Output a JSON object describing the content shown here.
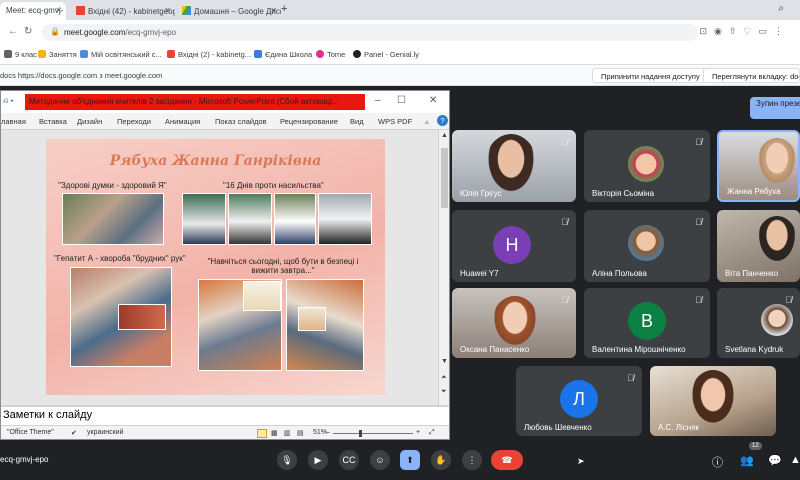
{
  "browser": {
    "tabs": [
      {
        "title": "Meet: ecq-gmvj-",
        "icon": "meet-icon"
      },
      {
        "title": "Вхідні (42) - kabinetgeog",
        "icon": "gmail-icon"
      },
      {
        "title": "Домашня – Google Диск",
        "icon": "drive-icon"
      }
    ],
    "url_host": "meet.google.com",
    "url_path": "/ecq-gmvj-epo",
    "bookmarks": [
      "9 клас",
      "Заняття",
      "Мій освітянський с...",
      "Вхідні (2) - kabinetg...",
      "Єдина Школа",
      "Tome",
      "Panel - Genial.ly"
    ],
    "share_text": "docs https://docs.google.com з meet.google.com",
    "stop_sharing": "Припинити надання доступу",
    "switch_tab": "Переглянути вкладку: docs."
  },
  "ppt": {
    "window_title": "Методичне об'єднання вчителів 2 засідання - Microsoft PowerPoint (Сбой активаці...",
    "ribbon_tabs": [
      "лавная",
      "Вставка",
      "Дизайн",
      "Переходи",
      "Анимация",
      "Показ слайдов",
      "Рецензирование",
      "Вид",
      "WPS PDF"
    ],
    "notes_placeholder": "Заметки к слайду",
    "status_theme": "\"Office Theme\"",
    "status_lang": "украинский",
    "zoom": "51%"
  },
  "slide": {
    "title": "Рябуха Жанна Ганріківна",
    "captions": [
      "\"Здорові думки - здоровий Я\"",
      "\"16 Днів проти насильства\"",
      "\"Гепатит А - хвороба \"брудних\" рук\"",
      "\"Навчіться сьогодні, щоб бути в безпеці і вижити завтра...\""
    ]
  },
  "meet": {
    "stop_presenting": "Зупин презент",
    "participants": [
      {
        "name": "Юлія Грігус",
        "type": "video",
        "muted": true
      },
      {
        "name": "Вікторія Сьоміна",
        "type": "photo",
        "muted": true
      },
      {
        "name": "Жанна Рябуха",
        "type": "video",
        "muted": false
      },
      {
        "name": "Huawei Y7",
        "type": "letter",
        "letter": "H",
        "color": "#7b3fb5",
        "muted": true
      },
      {
        "name": "Аліна Польова",
        "type": "photo",
        "muted": true
      },
      {
        "name": "Віта Панченко",
        "type": "video",
        "muted": false
      },
      {
        "name": "Оксана Панасенко",
        "type": "video",
        "muted": true
      },
      {
        "name": "Валентина Мірошніченко",
        "type": "letter",
        "letter": "В",
        "color": "#0b8043",
        "muted": true
      },
      {
        "name": "Svetlana Kydruk",
        "type": "photo",
        "muted": true
      },
      {
        "name": "Любовь Шевченко",
        "type": "letter",
        "letter": "Л",
        "color": "#1a73e8",
        "muted": true
      },
      {
        "name": "А.С. Лісняк",
        "type": "video",
        "muted": false
      }
    ],
    "meeting_code": "ecq-gmvj-epo",
    "participant_count": "12"
  }
}
